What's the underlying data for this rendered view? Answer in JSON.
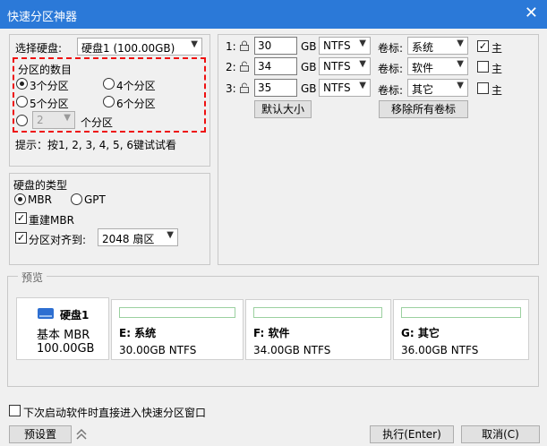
{
  "window": {
    "title": "快速分区神器",
    "close_glyph": "✕"
  },
  "disk_select": {
    "label": "选择硬盘:",
    "value": "硬盘1 (100.00GB)"
  },
  "partition_count": {
    "group_label": "分区的数目",
    "options": [
      "3个分区",
      "4个分区",
      "5个分区",
      "6个分区"
    ],
    "selected": 0,
    "custom_value": "2",
    "custom_suffix": "个分区",
    "hint": "提示：按1, 2, 3, 4, 5, 6键试试看"
  },
  "disk_type": {
    "group_label": "硬盘的类型",
    "mbr": "MBR",
    "gpt": "GPT",
    "rebuild_mbr": "重建MBR",
    "align_label": "分区对齐到:",
    "align_value": "2048 扇区"
  },
  "partitions": [
    {
      "num": "1:",
      "size": "30",
      "unit": "GB",
      "fs": "NTFS",
      "vol_label_text": "卷标:",
      "vol": "系统",
      "primary": "主",
      "primary_checked": true
    },
    {
      "num": "2:",
      "size": "34",
      "unit": "GB",
      "fs": "NTFS",
      "vol_label_text": "卷标:",
      "vol": "软件",
      "primary": "主",
      "primary_checked": false
    },
    {
      "num": "3:",
      "size": "35",
      "unit": "GB",
      "fs": "NTFS",
      "vol_label_text": "卷标:",
      "vol": "其它",
      "primary": "主",
      "primary_checked": false
    }
  ],
  "buttons": {
    "default_size": "默认大小",
    "remove_labels": "移除所有卷标",
    "preset": "预设置",
    "execute": "执行(Enter)",
    "cancel": "取消(C)"
  },
  "preview": {
    "label": "预览",
    "disk": {
      "name": "硬盘1",
      "type": "基本 MBR",
      "size": "100.00GB"
    },
    "parts": [
      {
        "title": "E: 系统",
        "size": "30.00GB NTFS"
      },
      {
        "title": "F: 软件",
        "size": "34.00GB NTFS"
      },
      {
        "title": "G: 其它",
        "size": "36.00GB NTFS"
      }
    ]
  },
  "footer": {
    "auto_enter": "下次启动软件时直接进入快速分区窗口"
  },
  "check_glyph": "✓",
  "colors": {
    "titlebar": "#2b79d8",
    "dash": "#e11111",
    "disk_icon": "#2e6fd1"
  }
}
